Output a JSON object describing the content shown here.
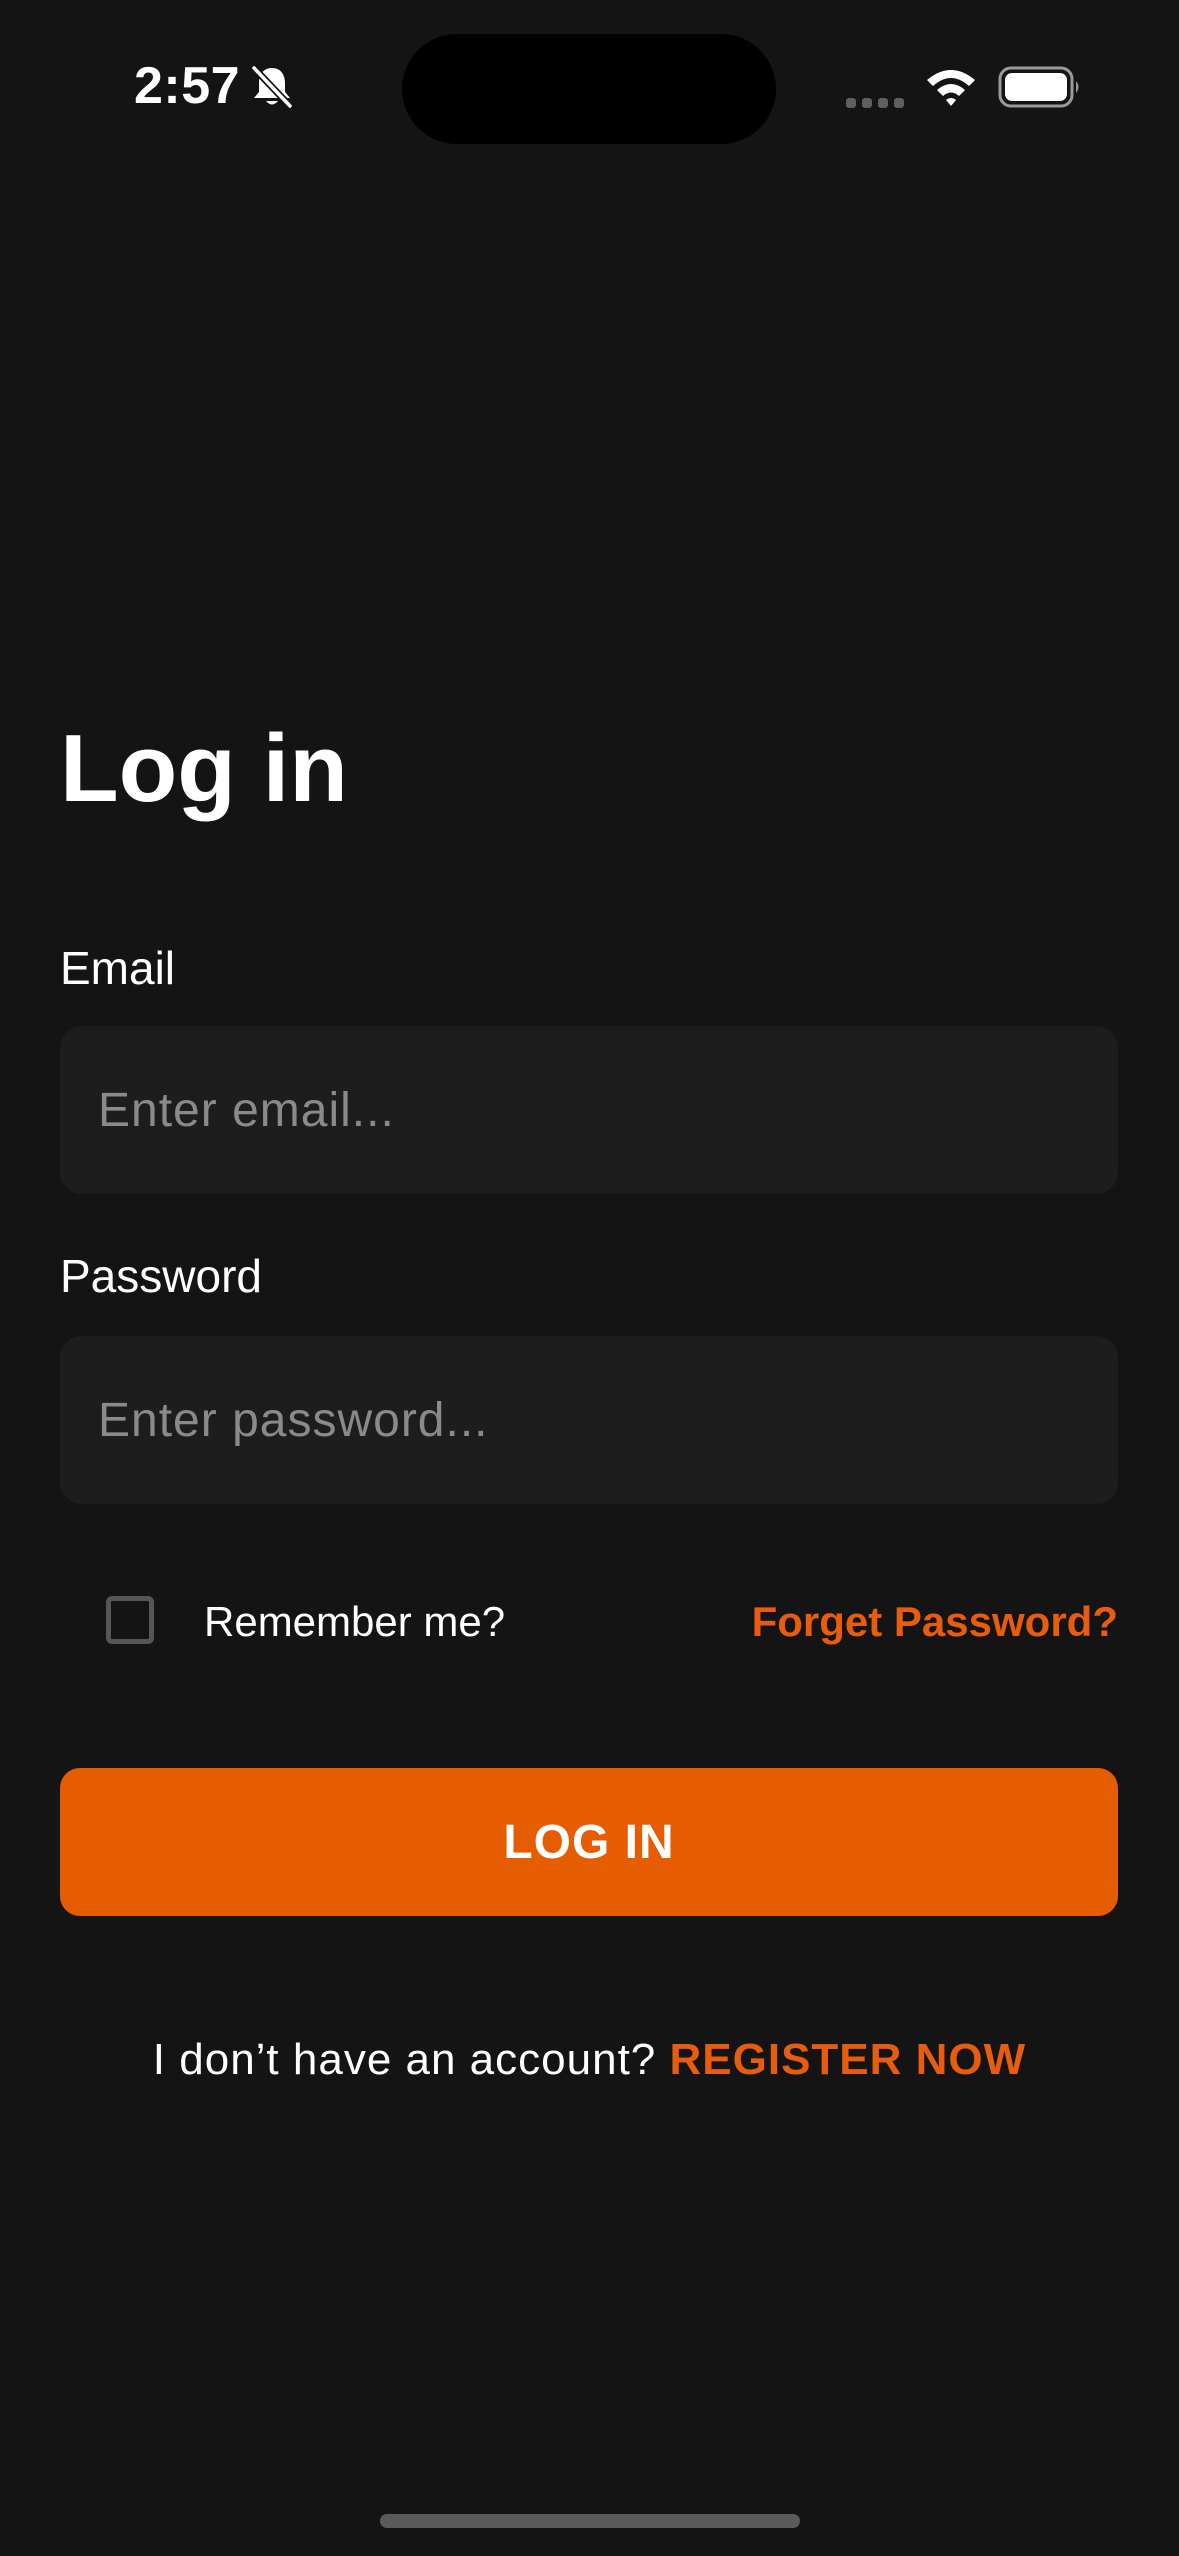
{
  "status_bar": {
    "time": "2:57",
    "icons": [
      "bell-slash-icon",
      "signal-icon",
      "wifi-icon",
      "battery-icon"
    ]
  },
  "login": {
    "title": "Log in",
    "email_label": "Email",
    "email_placeholder": "Enter email...",
    "email_value": "",
    "password_label": "Password",
    "password_placeholder": "Enter password...",
    "password_value": "",
    "remember_label": "Remember me?",
    "remember_checked": false,
    "forgot_label": "Forget Password?",
    "submit_label": "LOG IN",
    "register_prompt": "I don’t have an account?",
    "register_link": "REGISTER NOW"
  },
  "colors": {
    "background": "#141414",
    "input_background": "#1d1d1d",
    "accent": "#e65c00",
    "link": "#e85c0d",
    "placeholder": "#8a8a8a"
  }
}
